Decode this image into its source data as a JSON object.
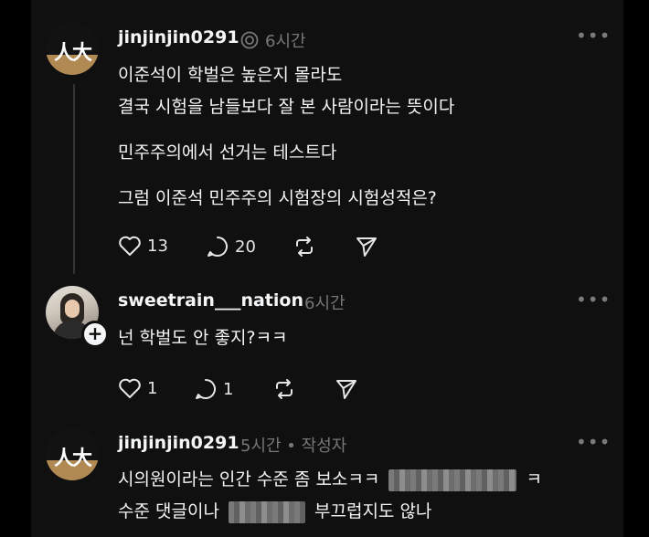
{
  "post1": {
    "username": "jinjinjin0291",
    "time": "6시간",
    "more": "•••",
    "avatar_mark": "人大",
    "lines": [
      "이준석이 학벌은 높은지 몰라도",
      "결국 시험을 남들보다 잘 본 사람이라는 뜻이다",
      "민주주의에서 선거는 테스트다",
      "그럼 이준석 민주주의 시험장의 시험성적은?"
    ],
    "likes": "13",
    "comments": "20"
  },
  "reply1": {
    "username": "sweetrain___nation",
    "time": "6시간",
    "more": "•••",
    "text": "넌 학벌도 안 좋지?ㅋㅋ",
    "likes": "1",
    "comments": "1",
    "plus": "+"
  },
  "reply2": {
    "username": "jinjinjin0291",
    "meta": "5시간 • 작성자",
    "more": "•••",
    "avatar_mark": "人大",
    "line1_a": "시의원이라는 인간 수준 좀 보소ㅋㅋ",
    "line1_b": "ㅋ",
    "line2_a": "수준 댓글이나",
    "line2_b": "부끄럽지도 않나"
  },
  "colors": {
    "background": "#101010",
    "text": "#f3f5f7",
    "muted": "#777777"
  }
}
